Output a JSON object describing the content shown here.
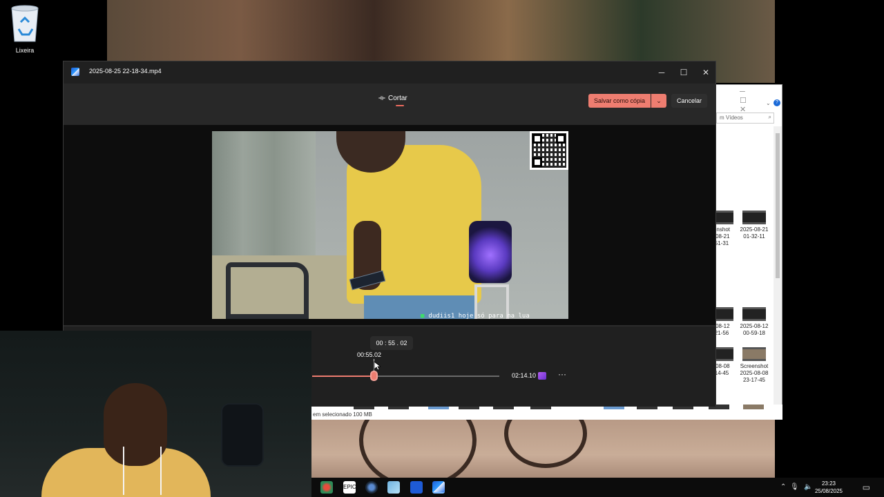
{
  "desktop": {
    "recycle_bin_label": "Lixeira"
  },
  "app": {
    "title": "2025-08-25 22-18-34.mp4",
    "toolbar": {
      "tab_label": "Cortar",
      "save_label": "Salvar como cópia",
      "save_dropdown_icon": "chevron-down-icon",
      "cancel_label": "Cancelar"
    },
    "video": {
      "caption_user": "dudiis1",
      "caption_text": "hoje só para na lua"
    },
    "timeline": {
      "hover_time": "00 : 55 . 02",
      "current_time": "00:55.02",
      "end_time": "02:14.10",
      "more_label": "···",
      "played_fraction": 0.41
    }
  },
  "explorer": {
    "search_placeholder": "m Vídeos",
    "thumbs": [
      {
        "label_1": "enshot",
        "label_2": "-08-21",
        "label_3": "51-31"
      },
      {
        "label_1": "2025-08-21",
        "label_2": "01-32-11",
        "label_3": ""
      },
      {
        "label_1": "-08-12",
        "label_2": "21-56",
        "label_3": ""
      },
      {
        "label_1": "2025-08-12",
        "label_2": "00-59-18",
        "label_3": ""
      },
      {
        "label_1": "-08-08",
        "label_2": "14-45",
        "label_3": ""
      },
      {
        "label_1": "Screenshot",
        "label_2": "2025-08-08",
        "label_3": "23-17-45"
      }
    ],
    "status": "em selecionado  100 MB"
  },
  "taskbar": {
    "time": "23:23",
    "date": "25/08/2025"
  },
  "colors": {
    "accent": "#ee7d70",
    "window_bg": "#202020",
    "toolbar_bg": "#282828"
  }
}
